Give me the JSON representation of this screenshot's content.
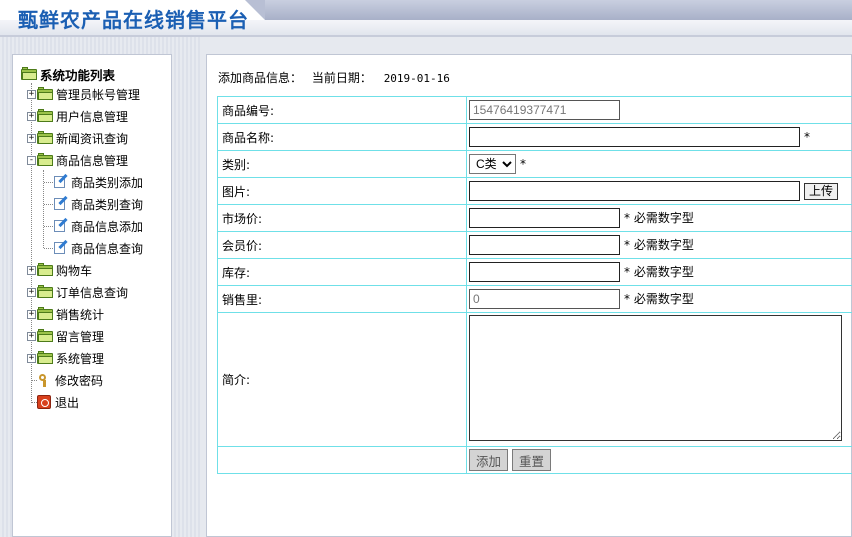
{
  "header": {
    "title": "甄鲜农产品在线销售平台"
  },
  "sidebar": {
    "root_label": "系统功能列表",
    "items": [
      {
        "label": "管理员帐号管理",
        "expander": "+"
      },
      {
        "label": "用户信息管理",
        "expander": "+"
      },
      {
        "label": "新闻资讯查询",
        "expander": "+"
      },
      {
        "label": "商品信息管理",
        "expander": "-"
      },
      {
        "label": "商品类别添加"
      },
      {
        "label": "商品类别查询"
      },
      {
        "label": "商品信息添加"
      },
      {
        "label": "商品信息查询"
      },
      {
        "label": "购物车",
        "expander": "+"
      },
      {
        "label": "订单信息查询",
        "expander": "+"
      },
      {
        "label": "销售统计",
        "expander": "+"
      },
      {
        "label": "留言管理",
        "expander": "+"
      },
      {
        "label": "系统管理",
        "expander": "+"
      },
      {
        "label": "修改密码"
      },
      {
        "label": "退出"
      }
    ]
  },
  "main": {
    "heading": "添加商品信息：",
    "date_label": "当前日期：",
    "date_value": "2019-01-16",
    "form": {
      "code_label": "商品编号:",
      "code_value": "15476419377471",
      "name_label": "商品名称:",
      "name_value": "",
      "category_label": "类别:",
      "category_value": "C类",
      "image_label": "图片:",
      "image_value": "",
      "upload_label": "上传",
      "market_price_label": "市场价:",
      "market_price_value": "",
      "member_price_label": "会员价:",
      "member_price_value": "",
      "stock_label": "库存:",
      "stock_value": "",
      "sales_label": "销售里:",
      "sales_value": "0",
      "desc_label": "简介:",
      "desc_value": "",
      "required_mark": "*",
      "numeric_hint": "* 必需数字型",
      "add_button": "添加",
      "reset_button": "重置"
    }
  },
  "colors": {
    "title_blue": "#1b5fb3",
    "table_border": "#6fe0e8",
    "folder_green": "#9cc34a"
  }
}
